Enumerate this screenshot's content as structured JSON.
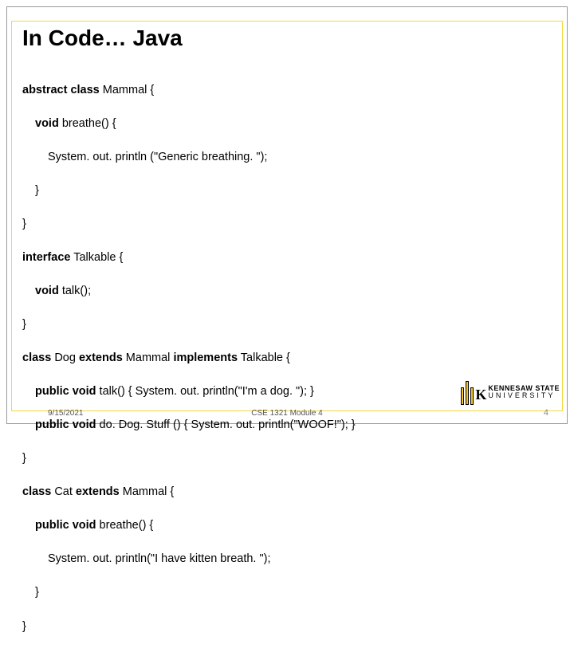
{
  "title": "In Code… Java",
  "code": {
    "l1a": "abstract class",
    "l1b": " Mammal {",
    "l2a": "void",
    "l2b": " breathe() {",
    "l3": "System. out. println (\"Generic breathing. \");",
    "l4": "}",
    "l5": "}",
    "l6a": "interface",
    "l6b": " Talkable {",
    "l7a": "void",
    "l7b": " talk();",
    "l8": "}",
    "l9a": "class",
    "l9b": " Dog ",
    "l9c": "extends",
    "l9d": " Mammal ",
    "l9e": "implements",
    "l9f": " Talkable {",
    "l10a": "public void",
    "l10b": " talk() { System. out. println(\"I'm a dog. \"); }",
    "l11a": "public void",
    "l11b": " do. Dog. Stuff () { System. out. println(\"WOOF!\"); }",
    "l12": "}",
    "l13a": "class",
    "l13b": " Cat ",
    "l13c": "extends",
    "l13d": " Mammal {",
    "l14a": "public void",
    "l14b": " breathe() {",
    "l15": "System. out. println(\"I have kitten breath. \");",
    "l16": "}",
    "l17": "}"
  },
  "footer": {
    "date": "9/15/2021",
    "module": "CSE 1321 Module 4",
    "page": "4"
  },
  "logo": {
    "line1": "KENNESAW STATE",
    "line2": "UNIVERSITY"
  }
}
